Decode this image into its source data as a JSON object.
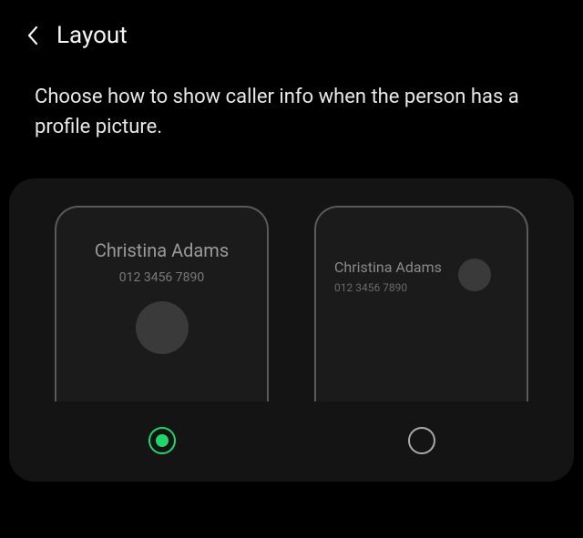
{
  "header": {
    "title": "Layout"
  },
  "description": "Choose how to show caller info when the person has a profile picture.",
  "options": {
    "caller_name": "Christina Adams",
    "caller_number": "012 3456 7890",
    "selected_index": 0
  },
  "colors": {
    "accent": "#1fd66b"
  }
}
